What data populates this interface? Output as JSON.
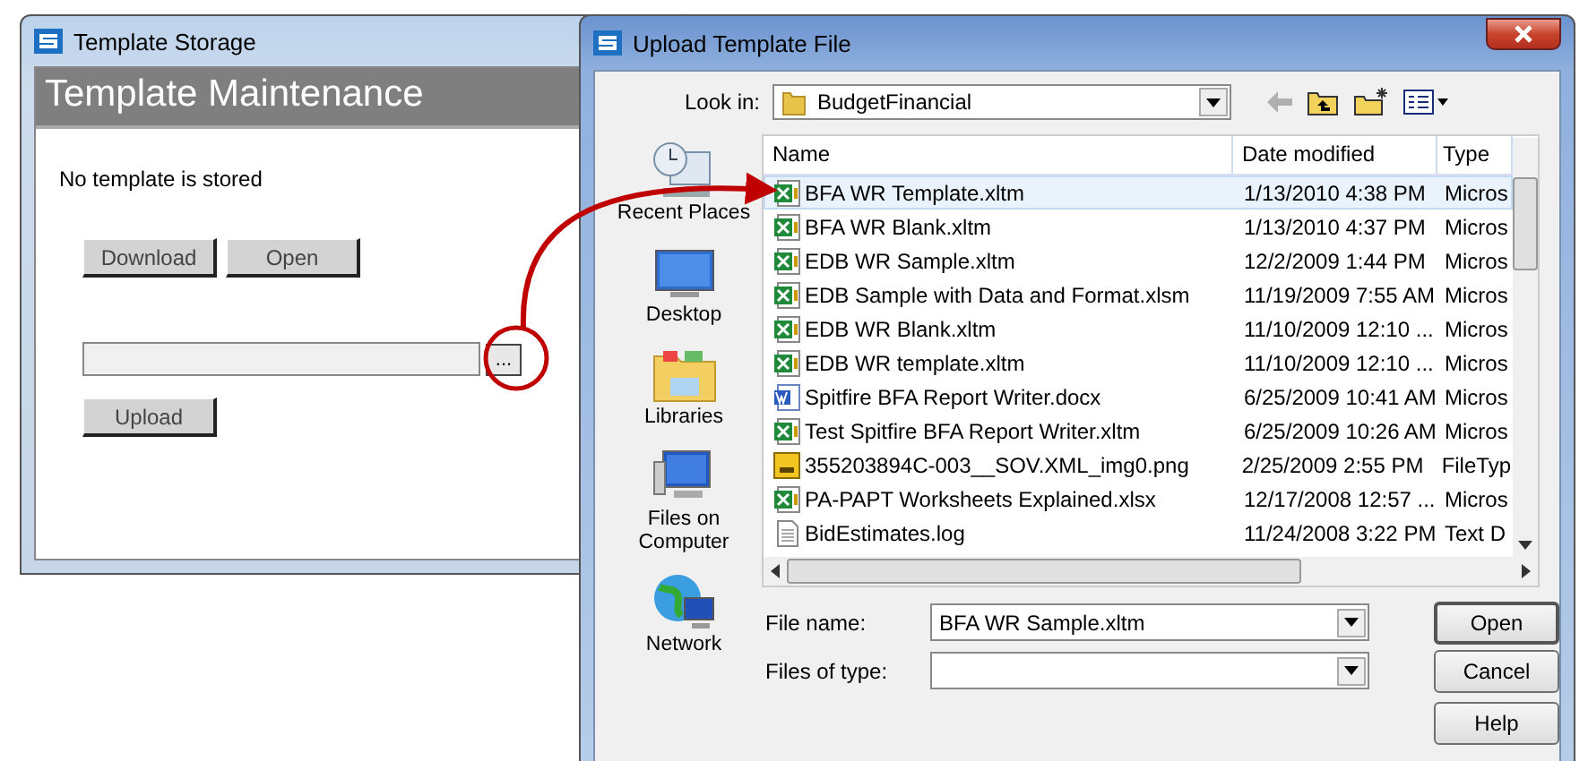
{
  "left_window": {
    "title": "Template Storage",
    "header": "Template Maintenance",
    "status": "No template is stored",
    "buttons": [
      "Download",
      "Open"
    ],
    "browse_label": "...",
    "upload_label": "Upload"
  },
  "dialog": {
    "title": "Upload Template File",
    "look_in_label": "Look in:",
    "look_in_value": "BudgetFinancial",
    "places": [
      {
        "label": "Recent Places",
        "kind": "recent"
      },
      {
        "label": "Desktop",
        "kind": "desktop"
      },
      {
        "label": "Libraries",
        "kind": "libraries"
      },
      {
        "label": "Files on Computer",
        "kind": "computer"
      },
      {
        "label": "Network",
        "kind": "network"
      }
    ],
    "columns": [
      "Name",
      "Date modified",
      "Type"
    ],
    "rows": [
      {
        "name": "BFA WR Template.xltm",
        "date": "1/13/2010 4:38 PM",
        "type": "Micros",
        "kind": "excel",
        "selected": true
      },
      {
        "name": "BFA WR Blank.xltm",
        "date": "1/13/2010 4:37 PM",
        "type": "Micros",
        "kind": "excel",
        "selected": false
      },
      {
        "name": "EDB WR Sample.xltm",
        "date": "12/2/2009 1:44 PM",
        "type": "Micros",
        "kind": "excel",
        "selected": false
      },
      {
        "name": "EDB Sample with Data and Format.xlsm",
        "date": "11/19/2009 7:55 AM",
        "type": "Micros",
        "kind": "excel",
        "selected": false
      },
      {
        "name": "EDB WR Blank.xltm",
        "date": "11/10/2009 12:10 ...",
        "type": "Micros",
        "kind": "excel",
        "selected": false
      },
      {
        "name": "EDB WR template.xltm",
        "date": "11/10/2009 12:10 ...",
        "type": "Micros",
        "kind": "excel",
        "selected": false
      },
      {
        "name": "Spitfire BFA Report Writer.docx",
        "date": "6/25/2009 10:41 AM",
        "type": "Micros",
        "kind": "word",
        "selected": false
      },
      {
        "name": "Test Spitfire BFA Report Writer.xltm",
        "date": "6/25/2009 10:26 AM",
        "type": "Micros",
        "kind": "excel",
        "selected": false
      },
      {
        "name": "355203894C-003__SOV.XML_img0.png",
        "date": "2/25/2009 2:55 PM",
        "type": "FileTyp",
        "kind": "image",
        "selected": false
      },
      {
        "name": "PA-PAPT Worksheets Explained.xlsx",
        "date": "12/17/2008 12:57 ...",
        "type": "Micros",
        "kind": "excel",
        "selected": false
      },
      {
        "name": "BidEstimates.log",
        "date": "11/24/2008 3:22 PM",
        "type": "Text D",
        "kind": "text",
        "selected": false
      }
    ],
    "file_name_label": "File name:",
    "file_name_value": "BFA WR Sample.xltm",
    "file_type_label": "Files of type:",
    "buttons": [
      "Open",
      "Cancel",
      "Help"
    ]
  }
}
